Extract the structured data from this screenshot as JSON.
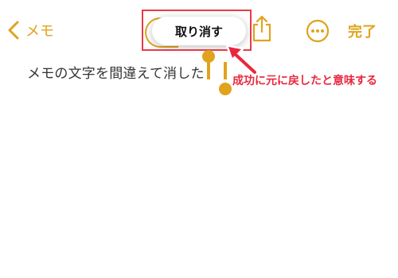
{
  "nav": {
    "back_label": "メモ",
    "done_label": "完了",
    "back_icon": "chevron-left-icon",
    "share_icon": "share-icon",
    "more_icon": "ellipsis-circle-icon"
  },
  "popup": {
    "undo_label": "取り消す"
  },
  "note": {
    "text": "メモの文字を間違えて消した"
  },
  "annotation": {
    "text": "成功に元に戻したと意味する"
  },
  "colors": {
    "accent": "#e0a31d",
    "annotation_red": "#e8283e",
    "text": "#333333"
  }
}
